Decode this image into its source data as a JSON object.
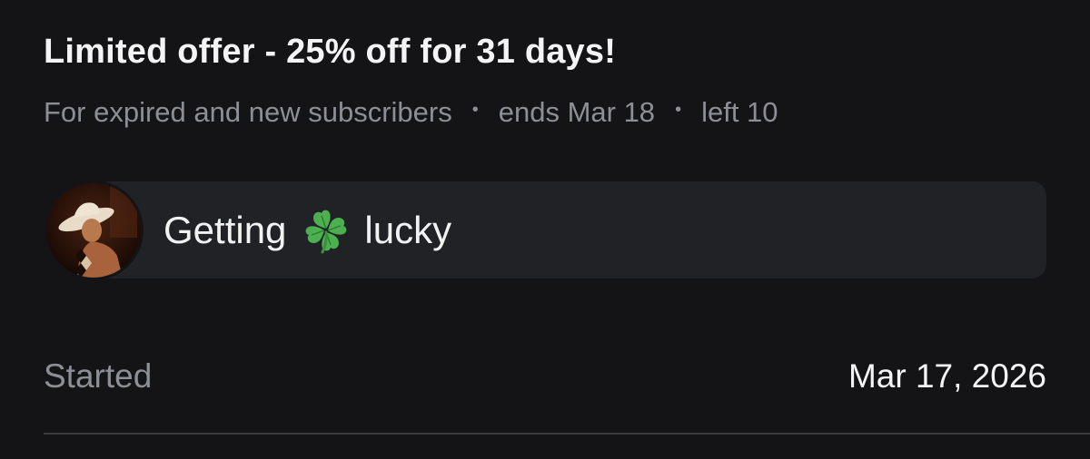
{
  "offer": {
    "title": "Limited offer - 25% off for 31 days!",
    "audience": "For expired and new subscribers",
    "separator": "•",
    "ends": "ends Mar 18",
    "left": "left 10"
  },
  "message": {
    "text_before": "Getting",
    "text_after": "lucky",
    "emoji_icon": "four-leaf-clover-icon",
    "avatar_icon": "avatar"
  },
  "details": {
    "started_label": "Started",
    "started_value": "Mar 17, 2026"
  },
  "colors": {
    "background": "#141416",
    "bubble": "#212226",
    "muted_text": "#8d8f96",
    "primary_text": "#f4f4f4",
    "clover": "#4caf50"
  }
}
